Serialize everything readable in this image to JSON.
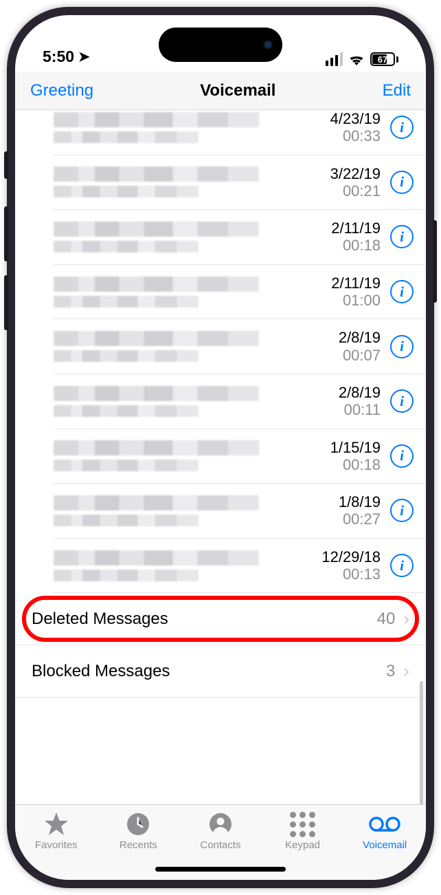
{
  "status": {
    "time": "5:50",
    "battery": "67"
  },
  "nav": {
    "left": "Greeting",
    "title": "Voicemail",
    "right": "Edit"
  },
  "voicemails": [
    {
      "date": "4/23/19",
      "duration": "00:33"
    },
    {
      "date": "3/22/19",
      "duration": "00:21"
    },
    {
      "date": "2/11/19",
      "duration": "00:18"
    },
    {
      "date": "2/11/19",
      "duration": "01:00"
    },
    {
      "date": "2/8/19",
      "duration": "00:07"
    },
    {
      "date": "2/8/19",
      "duration": "00:11"
    },
    {
      "date": "1/15/19",
      "duration": "00:18"
    },
    {
      "date": "1/8/19",
      "duration": "00:27"
    },
    {
      "date": "12/29/18",
      "duration": "00:13"
    }
  ],
  "deleted": {
    "label": "Deleted Messages",
    "count": "40"
  },
  "blocked": {
    "label": "Blocked Messages",
    "count": "3"
  },
  "tabs": {
    "favorites": "Favorites",
    "recents": "Recents",
    "contacts": "Contacts",
    "keypad": "Keypad",
    "voicemail": "Voicemail"
  }
}
